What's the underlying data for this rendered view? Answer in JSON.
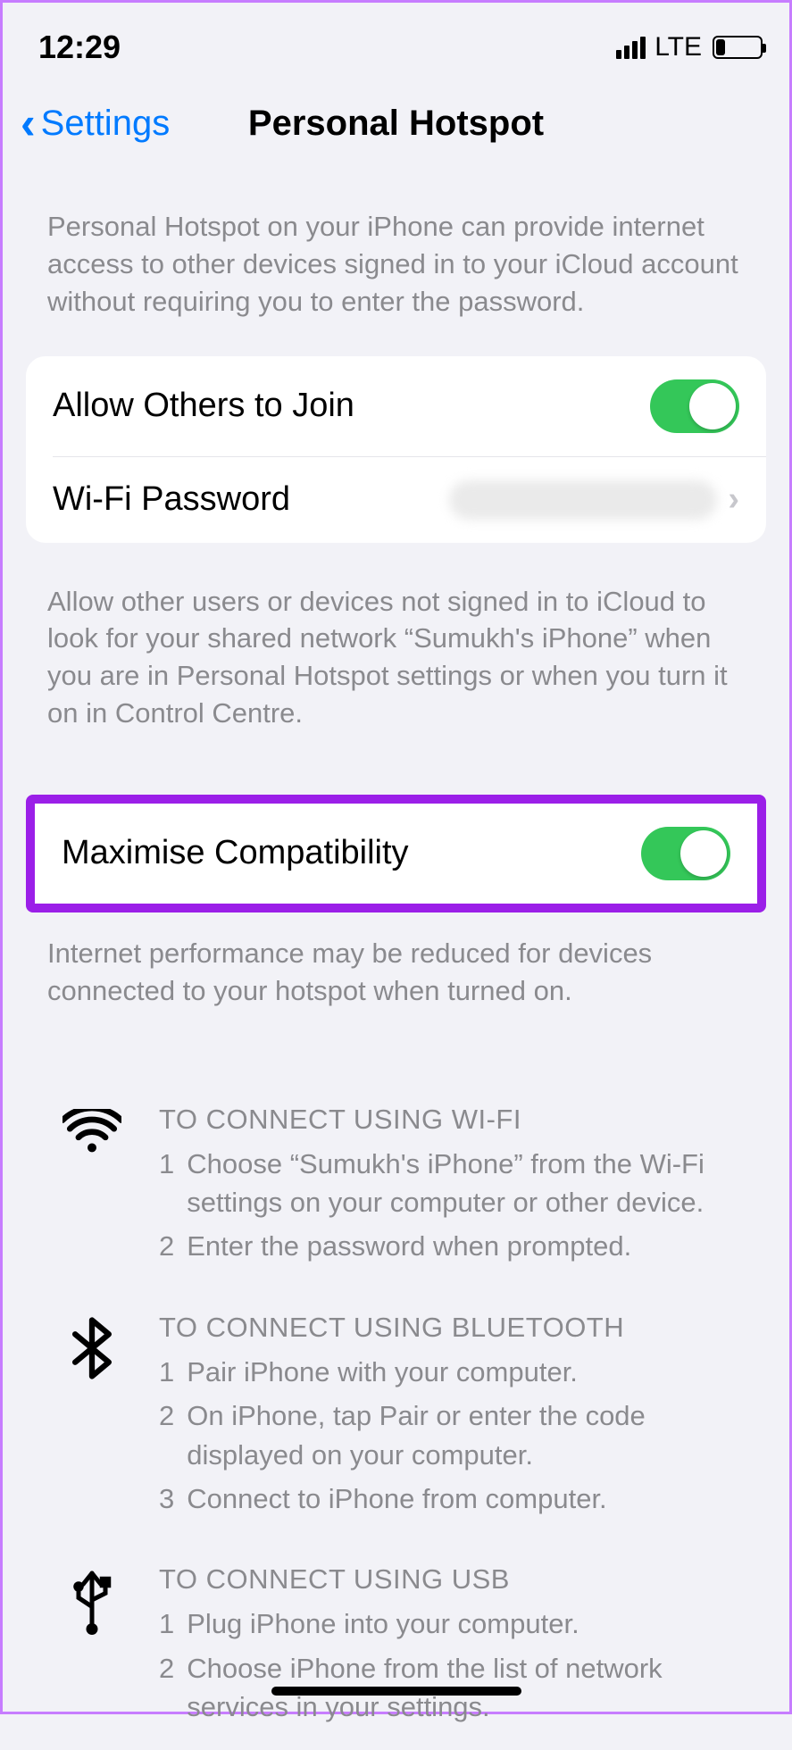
{
  "status": {
    "time": "12:29",
    "network_type": "LTE"
  },
  "nav": {
    "back_label": "Settings",
    "title": "Personal Hotspot"
  },
  "intro_text": "Personal Hotspot on your iPhone can provide internet access to other devices signed in to your iCloud account without requiring you to enter the password.",
  "rows": {
    "allow_others": {
      "label": "Allow Others to Join",
      "on": true
    },
    "wifi_password": {
      "label": "Wi-Fi Password"
    }
  },
  "allow_footer": "Allow other users or devices not signed in to iCloud to look for your shared network “Sumukh's iPhone” when you are in Personal Hotspot settings or when you turn it on in Control Centre.",
  "max_compat": {
    "label": "Maximise Compatibility",
    "on": true
  },
  "max_compat_footer": "Internet performance may be reduced for devices connected to your hotspot when turned on.",
  "connect": {
    "wifi": {
      "title": "TO CONNECT USING WI-FI",
      "steps": [
        "Choose “Sumukh's iPhone” from the Wi-Fi settings on your computer or other device.",
        "Enter the password when prompted."
      ]
    },
    "bluetooth": {
      "title": "TO CONNECT USING BLUETOOTH",
      "steps": [
        "Pair iPhone with your computer.",
        "On iPhone, tap Pair or enter the code displayed on your computer.",
        "Connect to iPhone from computer."
      ]
    },
    "usb": {
      "title": "TO CONNECT USING USB",
      "steps": [
        "Plug iPhone into your computer.",
        "Choose iPhone from the list of network services in your settings."
      ]
    }
  }
}
